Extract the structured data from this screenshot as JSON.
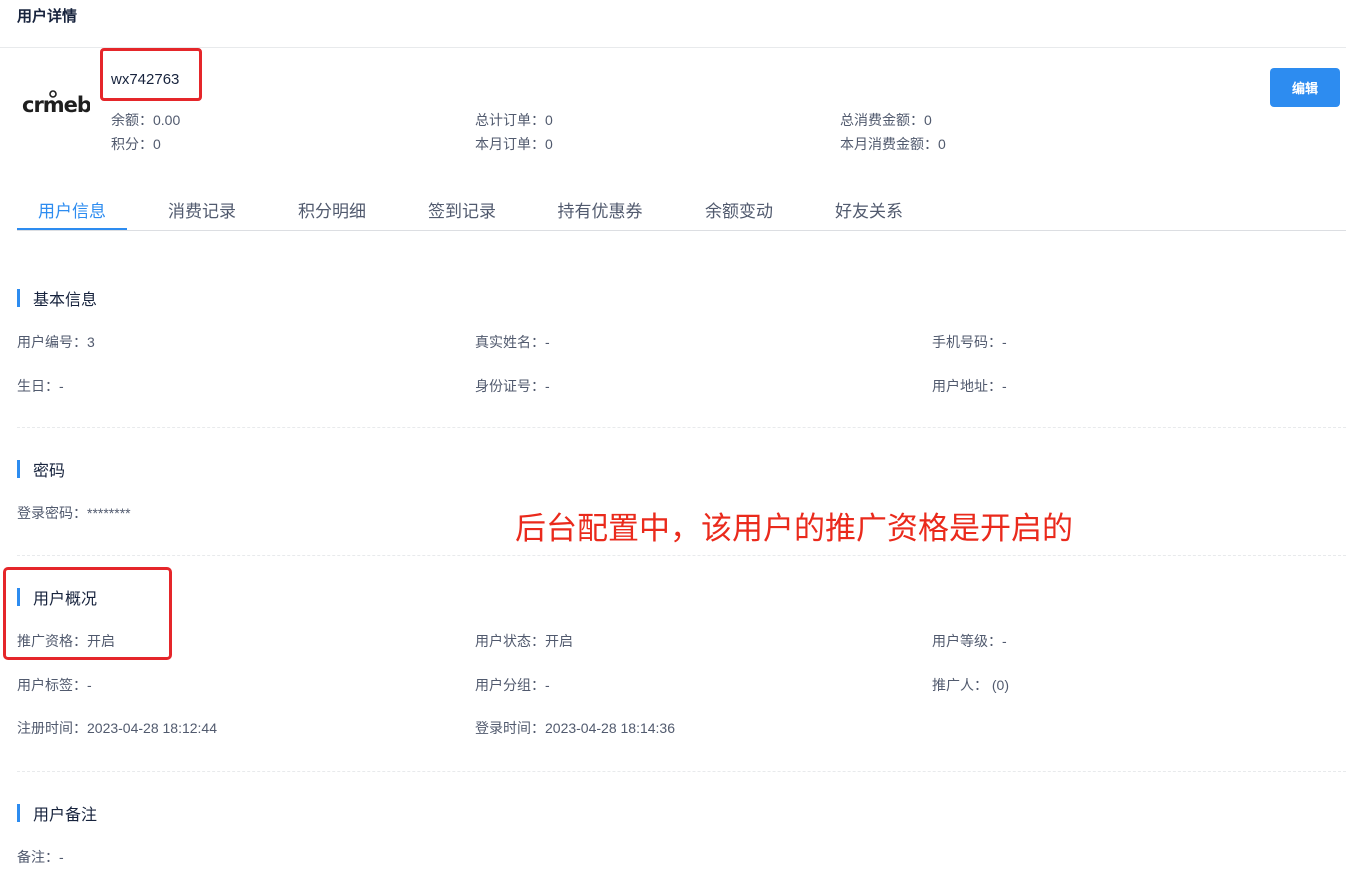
{
  "page": {
    "title": "用户详情"
  },
  "user": {
    "logo_text": "crmeb",
    "username": "wx742763",
    "edit_label": "编辑"
  },
  "stats": [
    {
      "label": "余额：",
      "value": "0.00"
    },
    {
      "label": "总计订单：",
      "value": "0"
    },
    {
      "label": "总消费金额：",
      "value": "0"
    },
    {
      "label": "积分：",
      "value": "0"
    },
    {
      "label": "本月订单：",
      "value": "0"
    },
    {
      "label": "本月消费金额：",
      "value": "0"
    }
  ],
  "tabs": [
    {
      "label": "用户信息",
      "active": true
    },
    {
      "label": "消费记录"
    },
    {
      "label": "积分明细"
    },
    {
      "label": "签到记录"
    },
    {
      "label": "持有优惠券"
    },
    {
      "label": "余额变动"
    },
    {
      "label": "好友关系"
    }
  ],
  "sections": {
    "basic": {
      "title": "基本信息",
      "fields": [
        {
          "label": "用户编号：",
          "value": "3"
        },
        {
          "label": "真实姓名：",
          "value": "-"
        },
        {
          "label": "手机号码：",
          "value": "-"
        },
        {
          "label": "生日：",
          "value": "-"
        },
        {
          "label": "身份证号：",
          "value": "-"
        },
        {
          "label": "用户地址：",
          "value": "-"
        }
      ]
    },
    "password": {
      "title": "密码",
      "fields": [
        {
          "label": "登录密码：",
          "value": "********"
        }
      ]
    },
    "overview": {
      "title": "用户概况",
      "fields": [
        {
          "label": "推广资格：",
          "value": "开启"
        },
        {
          "label": "用户状态：",
          "value": "开启"
        },
        {
          "label": "用户等级：",
          "value": "-"
        },
        {
          "label": "用户标签：",
          "value": "-"
        },
        {
          "label": "用户分组：",
          "value": "-"
        },
        {
          "label": "推广人：",
          "value": " (0)"
        },
        {
          "label": "注册时间：",
          "value": "2023-04-28 18:12:44"
        },
        {
          "label": "登录时间：",
          "value": "2023-04-28 18:14:36"
        }
      ]
    },
    "remark": {
      "title": "用户备注",
      "fields": [
        {
          "label": "备注：",
          "value": "-"
        }
      ]
    }
  },
  "annotation": {
    "text": "后台配置中，该用户的推广资格是开启的",
    "color": "#ea2a1c"
  },
  "colors": {
    "accent": "#2d8cf0",
    "highlight": "#e5262a"
  }
}
